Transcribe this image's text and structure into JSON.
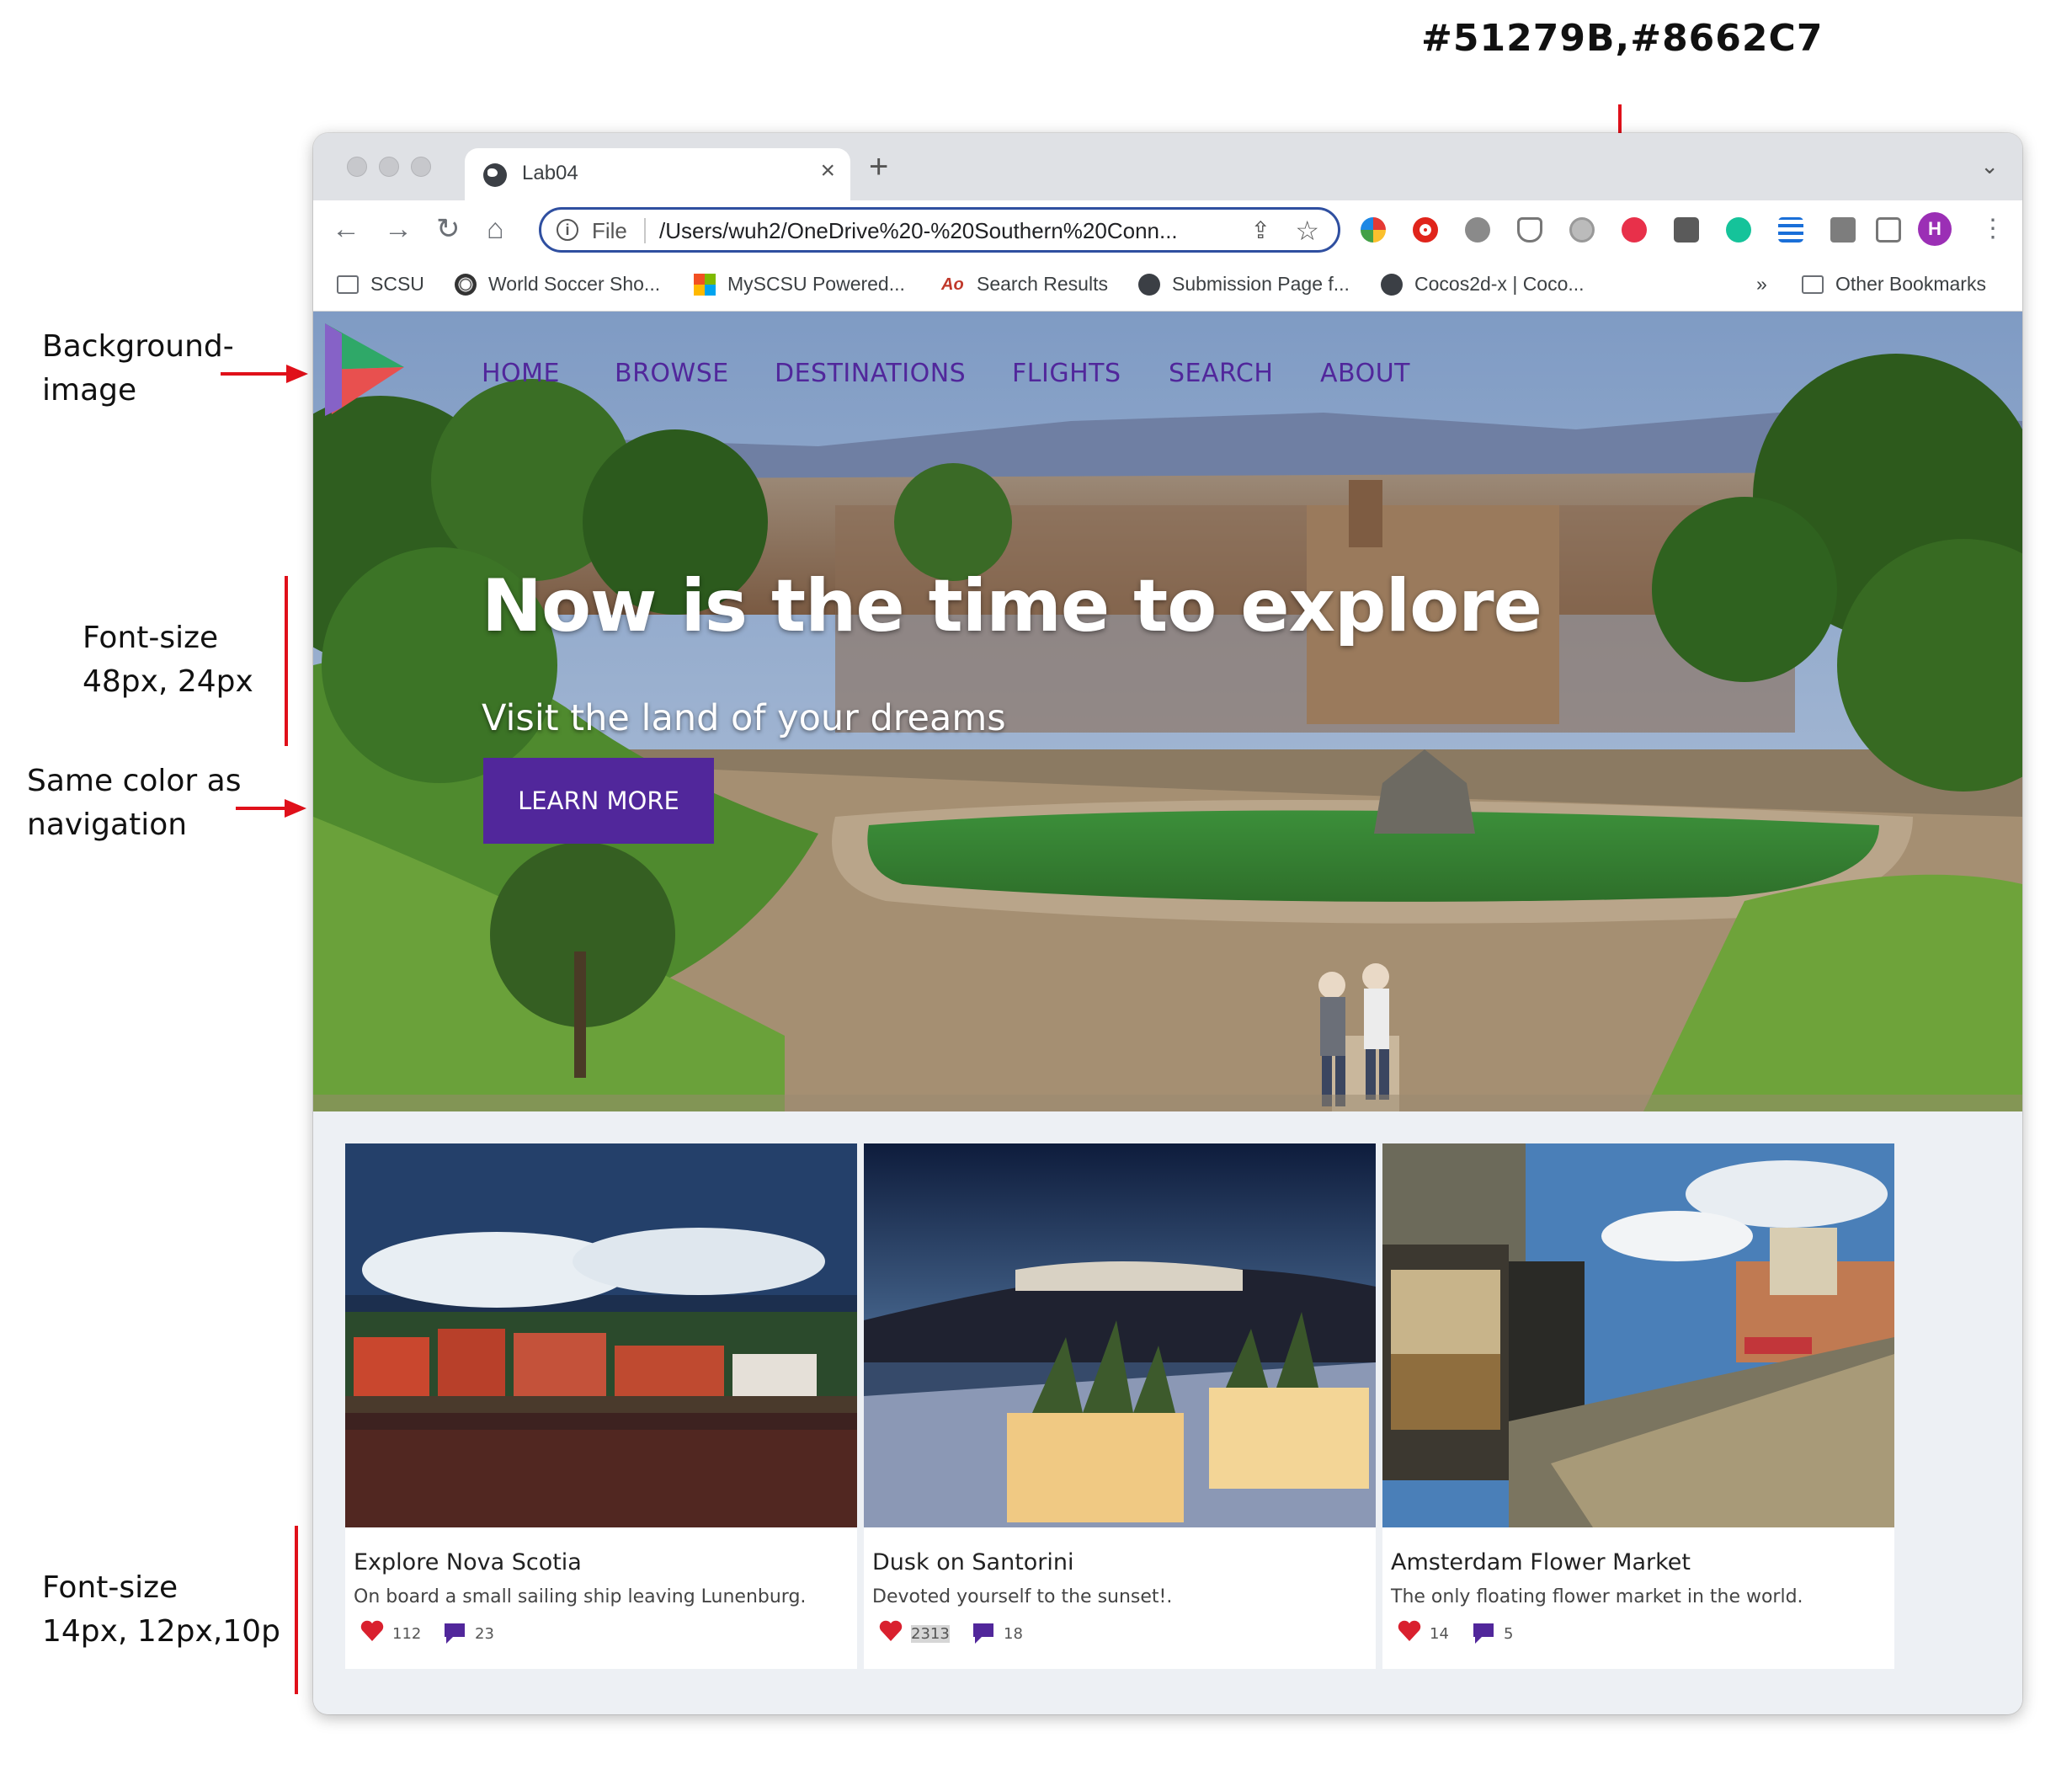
{
  "annotations": {
    "colors_hex": "#51279B,#8662C7",
    "background_image": [
      "Background-",
      "image"
    ],
    "font_size_top": [
      "Font-size",
      "48px, 24px"
    ],
    "same_color": [
      "Same color as",
      "navigation"
    ],
    "font_size_bottom": [
      "Font-size",
      "14px, 12px,10p"
    ]
  },
  "browser": {
    "tab_title": "Lab04",
    "url_scheme": "File",
    "url": "/Users/wuh2/OneDrive%20-%20Southern%20Conn...",
    "profile_initial": "H",
    "bookmarks": [
      {
        "label": "SCSU",
        "icon": "folder-icon"
      },
      {
        "label": "World Soccer Sho...",
        "icon": "soccer-ball-icon"
      },
      {
        "label": "MySCSU Powered...",
        "icon": "windows-logo-icon"
      },
      {
        "label": "Search Results",
        "icon": "search-results-icon"
      },
      {
        "label": "Submission Page f...",
        "icon": "globe-icon"
      },
      {
        "label": "Cocos2d-x | Coco...",
        "icon": "globe-icon"
      }
    ],
    "bookmarks_overflow": "»",
    "other_bookmarks": "Other Bookmarks"
  },
  "page": {
    "nav": [
      "HOME",
      "BROWSE",
      "DESTINATIONS",
      "FLIGHTS",
      "SEARCH",
      "ABOUT"
    ],
    "hero_title": "Now is the time to explore",
    "hero_subtitle": "Visit the land of your dreams",
    "cta": "LEARN MORE",
    "cards": [
      {
        "title": "Explore Nova Scotia",
        "description": "On board a small sailing ship leaving Lunenburg.",
        "likes": "112",
        "comments": "23"
      },
      {
        "title": "Dusk on Santorini",
        "description": "Devoted yourself to the sunset!.",
        "likes": "2313",
        "comments": "18"
      },
      {
        "title": "Amsterdam Flower Market",
        "description": "The only floating flower market in the world.",
        "likes": "14",
        "comments": "5"
      }
    ]
  },
  "colors": {
    "nav": "#51279b",
    "nav_secondary": "#8662c7",
    "annotation_red": "#e0101a",
    "page_bg": "#edf0f4"
  }
}
